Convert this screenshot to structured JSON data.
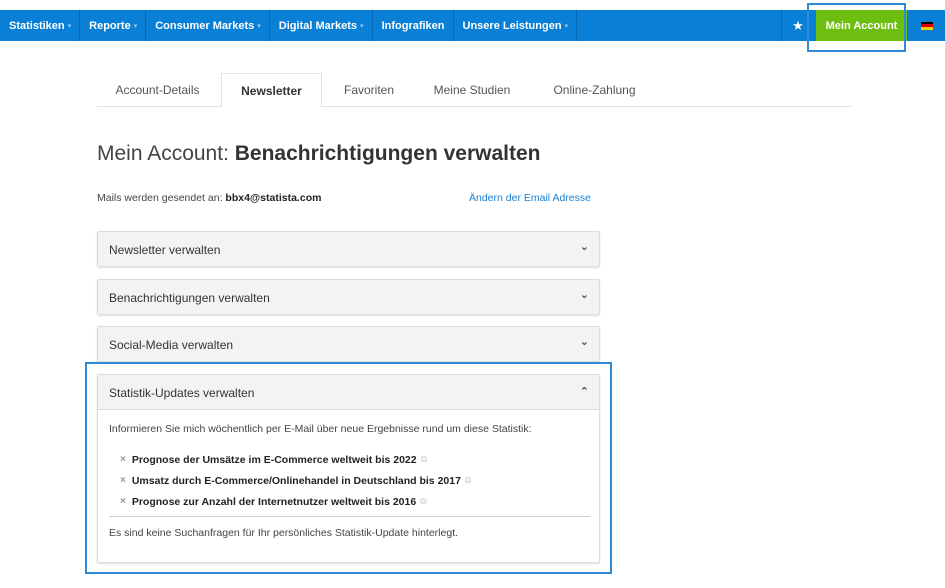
{
  "topnav": {
    "items": [
      {
        "label": "Statistiken",
        "dropdown": true
      },
      {
        "label": "Reporte",
        "dropdown": true
      },
      {
        "label": "Consumer Markets",
        "dropdown": true
      },
      {
        "label": "Digital Markets",
        "dropdown": true
      },
      {
        "label": "Infografiken",
        "dropdown": false
      },
      {
        "label": "Unsere Leistungen",
        "dropdown": true
      }
    ],
    "star_icon": "★",
    "account_label": "Mein Account",
    "flag_icon": "germany-flag",
    "colors": {
      "bar": "#0a7fd6",
      "account": "#6ebd11"
    }
  },
  "tabs": [
    "Account-Details",
    "Newsletter",
    "Favoriten",
    "Meine Studien",
    "Online-Zahlung"
  ],
  "active_tab": "Newsletter",
  "title": {
    "prefix": "Mein Account: ",
    "bold": "Benachrichtigungen verwalten"
  },
  "mail": {
    "label": "Mails werden gesendet an: ",
    "address": "bbx4@statista.com",
    "change_link": "Ändern der Email Adresse"
  },
  "accordions": [
    {
      "label": "Newsletter verwalten",
      "expanded": false,
      "icon": "chevron-down"
    },
    {
      "label": "Benachrichtigungen verwalten",
      "expanded": false,
      "icon": "chevron-down"
    },
    {
      "label": "Social-Media verwalten",
      "expanded": false,
      "icon": "chevron-down"
    }
  ],
  "stats_panel": {
    "label": "Statistik-Updates verwalten",
    "expanded": true,
    "icon": "chevron-up",
    "intro": "Informieren Sie mich wöchentlich per E-Mail über neue Ergebnisse rund um diese Statistik:",
    "items": [
      "Prognose der Umsätze im E-Commerce weltweit bis 2022",
      "Umsatz durch E-Commerce/Onlinehandel in Deutschland bis 2017",
      "Prognose zur Anzahl der Internetnutzer weltweit bis 2016"
    ],
    "remove_icon": "×",
    "link_icon": "⧉",
    "empty_note": "Es sind keine Suchanfragen für Ihr persönliches Statistik-Update hinterlegt."
  },
  "glyphs": {
    "chevron_down": "⌄",
    "chevron_up": "⌃",
    "caret": "▾"
  }
}
